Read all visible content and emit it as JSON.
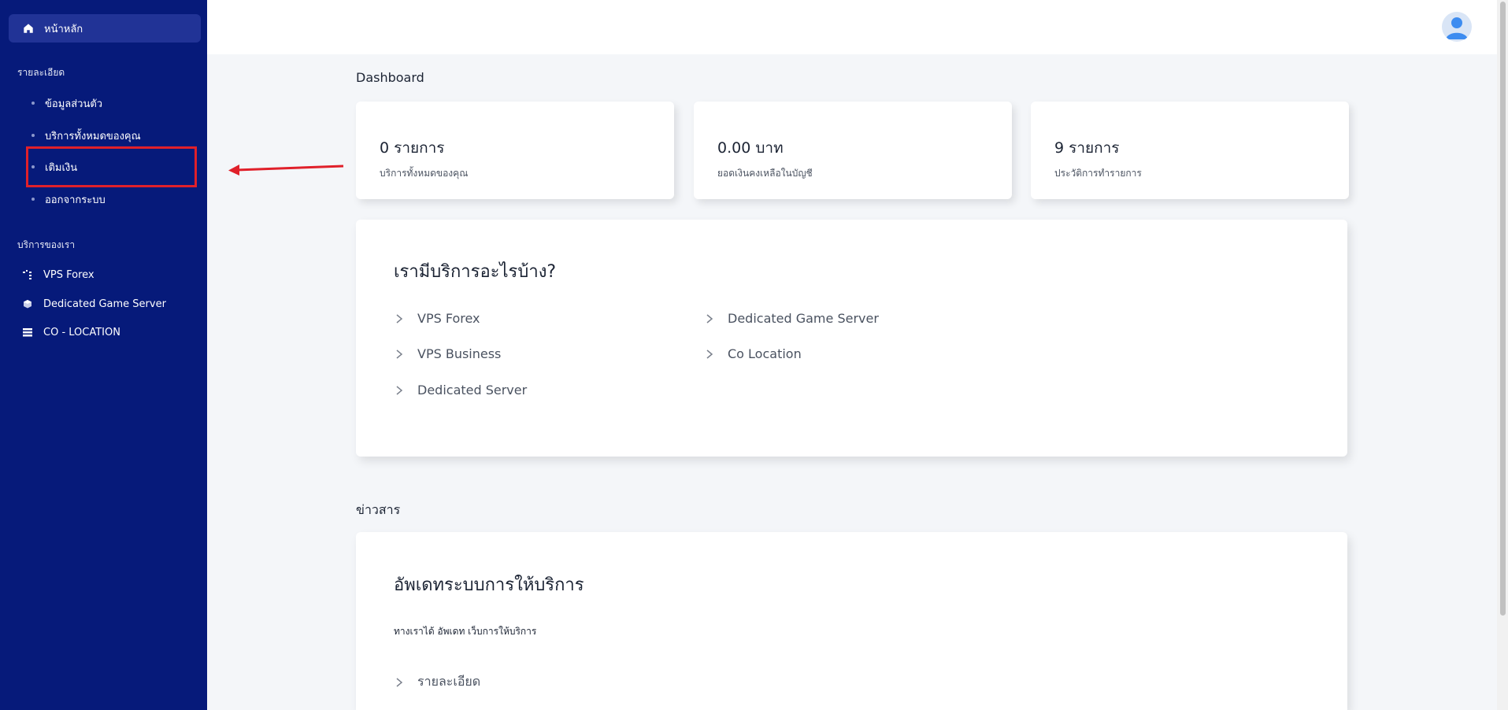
{
  "sidebar": {
    "home_label": "หน้าหลัก",
    "details_heading": "รายละเอียด",
    "details_items": [
      {
        "label": "ข้อมูลส่วนตัว"
      },
      {
        "label": "บริการทั้งหมดของคุณ"
      },
      {
        "label": "เติมเงิน"
      },
      {
        "label": "ออกจากระบบ"
      }
    ],
    "services_heading": "บริการของเรา",
    "service_items": [
      {
        "label": "VPS Forex",
        "icon": "vps-icon"
      },
      {
        "label": "Dedicated Game Server",
        "icon": "cube-icon"
      },
      {
        "label": "CO - LOCATION",
        "icon": "server-rack-icon"
      }
    ]
  },
  "main": {
    "dashboard_title": "Dashboard",
    "stats": [
      {
        "value": "0 รายการ",
        "label": "บริการทั้งหมดของคุณ"
      },
      {
        "value": "0.00 บาท",
        "label": "ยอดเงินคงเหลือในบัญชี"
      },
      {
        "value": "9 รายการ",
        "label": "ประวัติการทำรายการ"
      }
    ],
    "services_panel": {
      "title": "เรามีบริการอะไรบ้าง?",
      "links": [
        "VPS Forex",
        "VPS Business",
        "Dedicated Server",
        "Dedicated Game Server",
        "Co Location"
      ]
    },
    "news_title": "ข่าวสาร",
    "news_panel": {
      "title": "อัพเดทระบบการให้บริการ",
      "body": "ทางเราได้ อัพเดท เว็บการให้บริการ",
      "link": "รายละเอียด"
    }
  },
  "colors": {
    "sidebar_bg": "#061a7a",
    "sidebar_active": "#213396",
    "annotation": "#e0202a",
    "page_bg": "#f4f6f9"
  }
}
